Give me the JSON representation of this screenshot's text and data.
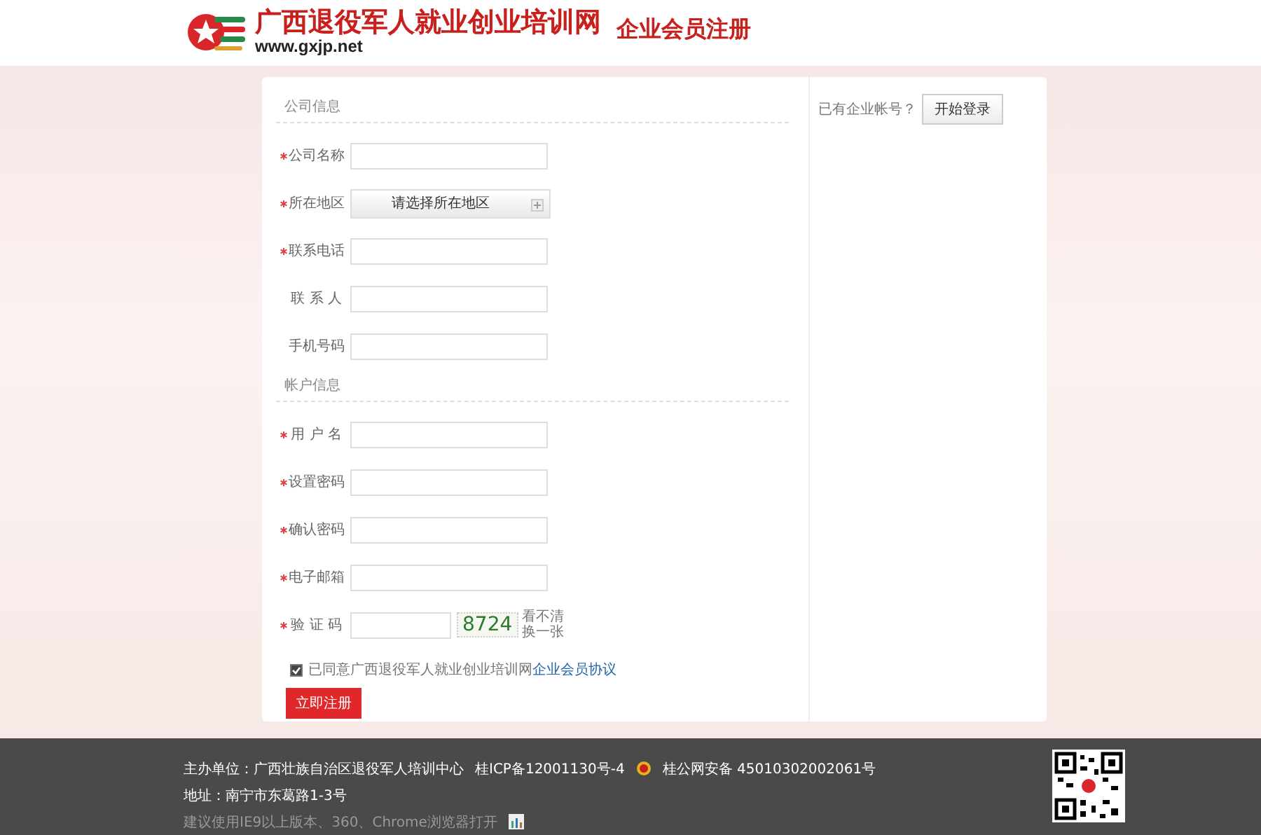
{
  "header": {
    "site_name": "广西退役军人就业创业培训网",
    "site_url": "www.gxjp.net",
    "page_title": "企业会员注册"
  },
  "sections": [
    {
      "title": "公司信息",
      "fields": [
        {
          "kind": "input",
          "label": "公司名称",
          "required": true
        },
        {
          "kind": "select",
          "label": "所在地区",
          "required": true,
          "value": "请选择所在地区"
        },
        {
          "kind": "input",
          "label": "联系电话",
          "required": true
        },
        {
          "kind": "input",
          "label": "联 系 人",
          "required": false
        },
        {
          "kind": "input",
          "label": "手机号码",
          "required": false
        }
      ]
    },
    {
      "title": "帐户信息",
      "fields": [
        {
          "kind": "input",
          "label": "用 户 名",
          "required": true
        },
        {
          "kind": "input",
          "label": "设置密码",
          "required": true
        },
        {
          "kind": "input",
          "label": "确认密码",
          "required": true
        },
        {
          "kind": "input",
          "label": "电子邮箱",
          "required": true
        },
        {
          "kind": "captcha",
          "label": "验 证 码",
          "required": true,
          "captcha_text": "8724",
          "refresh_text": "看不清换一张"
        }
      ]
    }
  ],
  "agreement": {
    "checked": true,
    "text": "已同意广西退役军人就业创业培训网",
    "link": "企业会员协议"
  },
  "submit_button": "立即注册",
  "login": {
    "prompt": "已有企业帐号？",
    "button": "开始登录"
  },
  "footer": {
    "sponsor": "主办单位：广西壮族自治区退役军人培训中心",
    "icp": "桂ICP备12001130号-4",
    "police": "桂公网安备 45010302002061号",
    "address": "地址：南宁市东葛路1-3号",
    "browser_note": "建议使用IE9以上版本、360、Chrome浏览器打开"
  }
}
